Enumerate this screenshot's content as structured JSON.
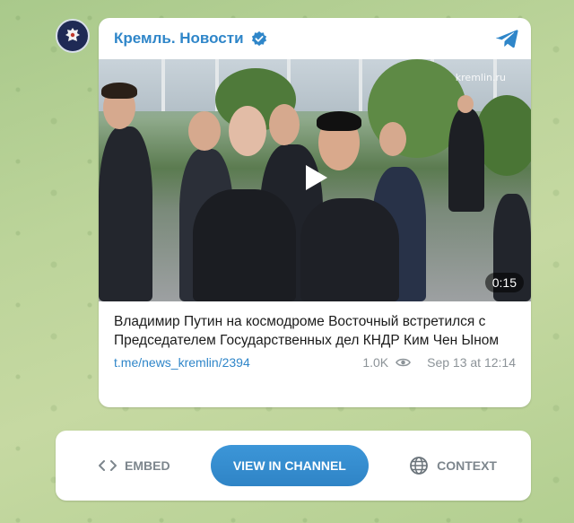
{
  "channel": {
    "name": "Кремль. Новости",
    "verified": true,
    "avatar_icon": "russian-coat-of-arms-icon"
  },
  "post": {
    "watermark": "kremlin.ru",
    "duration": "0:15",
    "text": "Владимир Путин на космодроме Восточный встретился с Председателем Государственных дел КНДР Ким Чен Ыном",
    "link": "t.me/news_kremlin/2394",
    "views": "1.0K",
    "date": "Sep 13 at 12:14"
  },
  "actions": {
    "embed_label": "EMBED",
    "view_label": "VIEW IN CHANNEL",
    "context_label": "CONTEXT"
  },
  "colors": {
    "accent": "#2f86c9",
    "background": "#bcd49a",
    "muted": "#8c9398"
  }
}
